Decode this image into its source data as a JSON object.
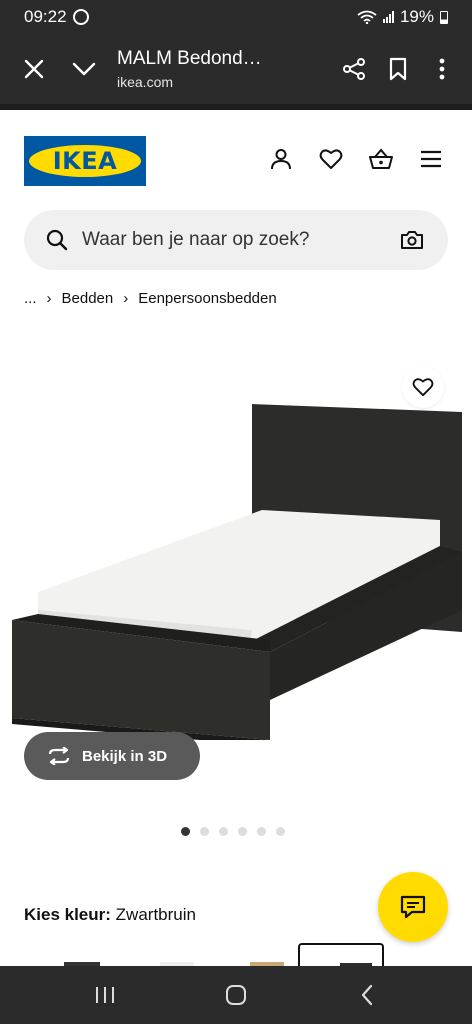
{
  "status_bar": {
    "time": "09:22",
    "battery": "19%",
    "icons": [
      "whatsapp-icon",
      "wifi-icon",
      "signal-icon",
      "battery-icon"
    ]
  },
  "browser": {
    "page_title": "MALM Bedond…",
    "domain": "ikea.com",
    "icons": [
      "close-icon",
      "chevron-down-icon",
      "share-icon",
      "bookmark-icon",
      "more-vertical-icon"
    ]
  },
  "header": {
    "logo_text": "IKEA",
    "icons": [
      "user-icon",
      "heart-icon",
      "basket-icon",
      "menu-icon"
    ],
    "brand_colors": {
      "blue": "#0058a3",
      "yellow": "#ffdb00"
    }
  },
  "search": {
    "placeholder": "Waar ben je naar op zoek?",
    "icons": [
      "search-icon",
      "camera-icon"
    ]
  },
  "breadcrumb": {
    "items": [
      "...",
      "Bedden",
      "Eenpersoonsbedden"
    ]
  },
  "product": {
    "view_3d_label": "Bekijk in 3D",
    "gallery_count": 6,
    "gallery_active": 0
  },
  "color": {
    "label": "Kies kleur:",
    "value": "Zwartbruin"
  },
  "chat": {
    "icon": "chat-icon",
    "color": "#ffdb00"
  },
  "navbar": {
    "icons": [
      "recent-apps-icon",
      "home-icon",
      "back-icon"
    ]
  }
}
